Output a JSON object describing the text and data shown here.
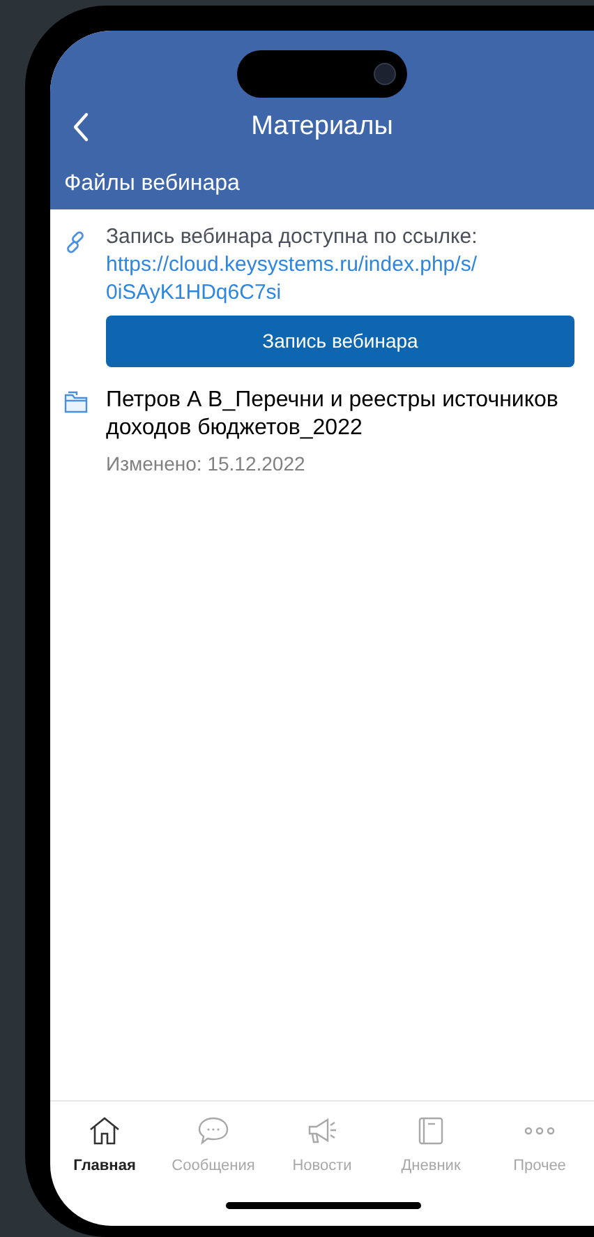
{
  "header": {
    "title": "Материалы",
    "subtitle": "Файлы вебинара"
  },
  "link_block": {
    "text": "Запись вебинара доступна по ссылке:",
    "url": "https://cloud.keysystems.ru/index.php/s/0iSAyK1HDq6C7si",
    "button": "Запись вебинара"
  },
  "files": [
    {
      "name": "Петров А В_Перечни и реестры источников доходов бюджетов_2022",
      "modified": "Изменено: 15.12.2022"
    }
  ],
  "tabs": [
    {
      "kind": "home",
      "label": "Главная",
      "selected": true
    },
    {
      "kind": "messages",
      "label": "Сообщения",
      "selected": false
    },
    {
      "kind": "news",
      "label": "Новости",
      "selected": false
    },
    {
      "kind": "diary",
      "label": "Дневник",
      "selected": false
    },
    {
      "kind": "more",
      "label": "Прочее",
      "selected": false
    }
  ]
}
